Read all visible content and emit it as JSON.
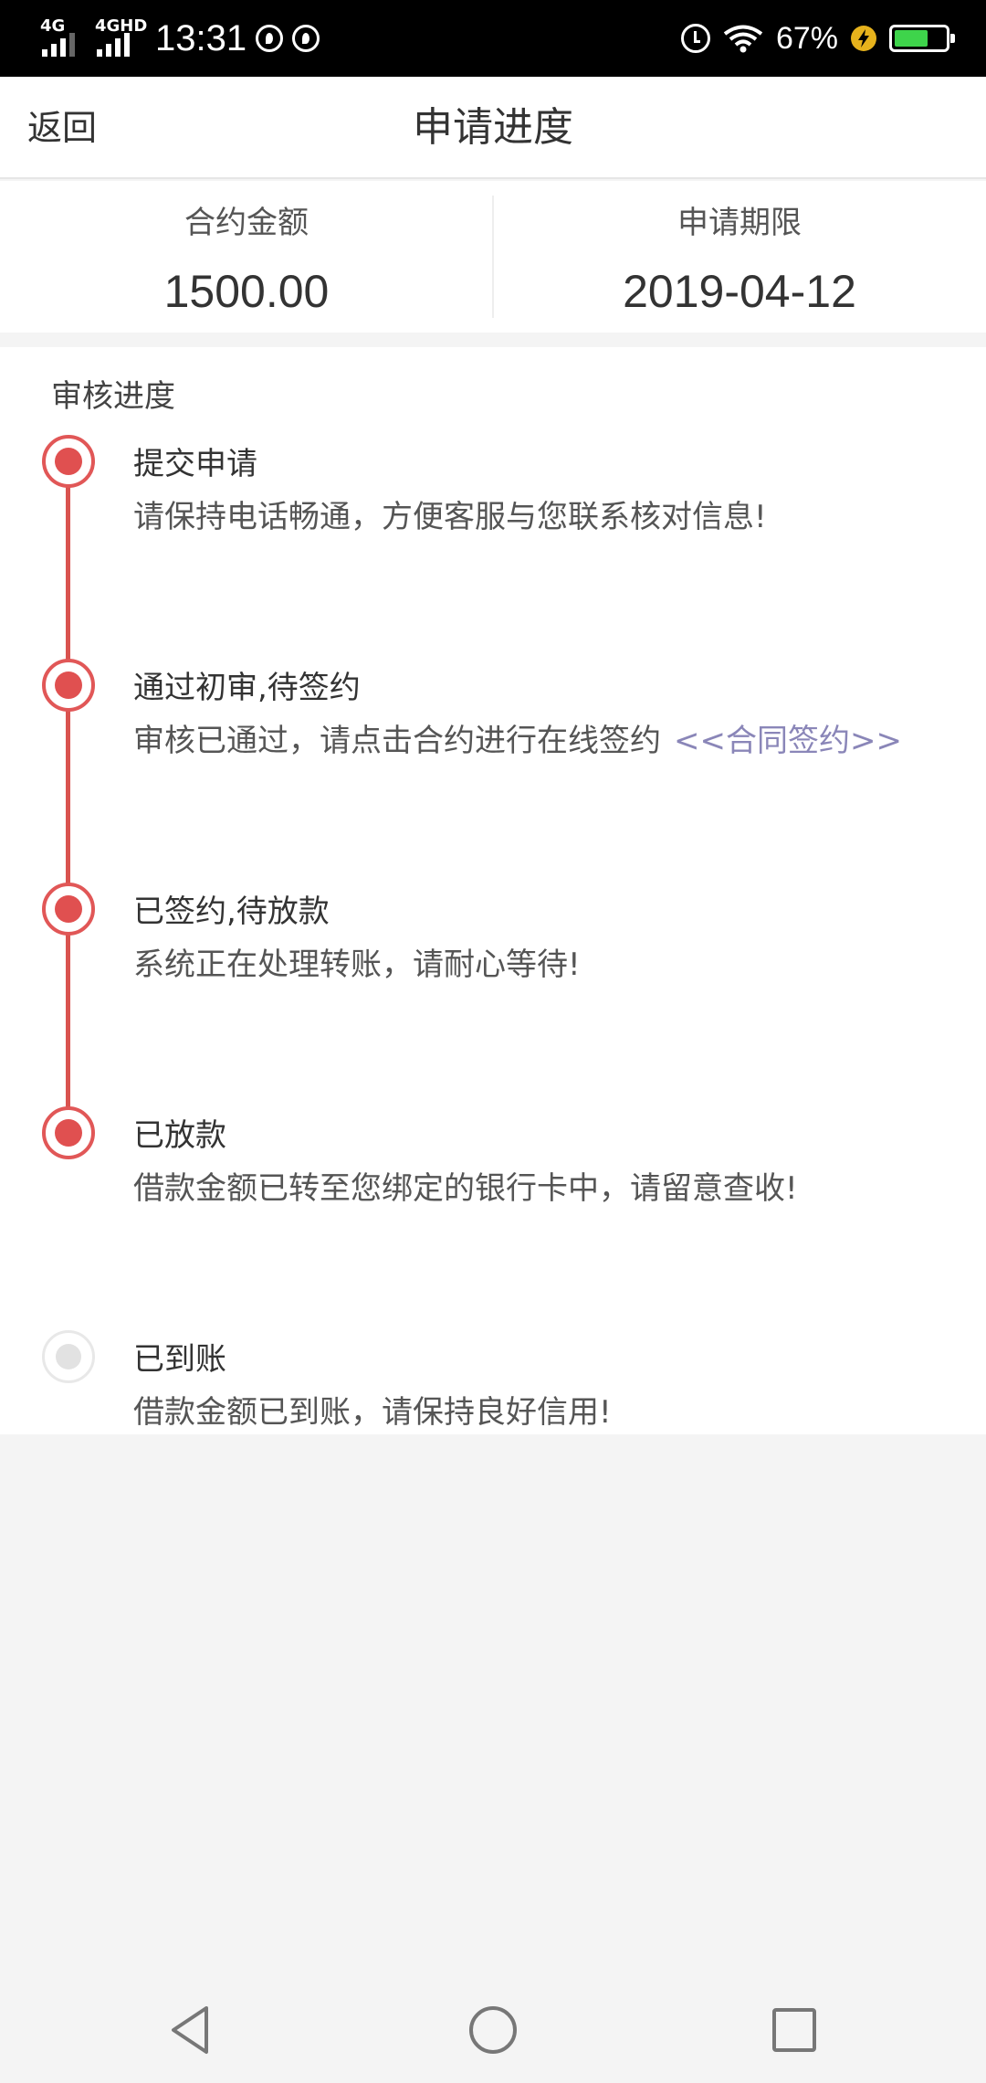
{
  "status_bar": {
    "network1": "4G",
    "network2": "4GHD",
    "time": "13:31",
    "battery_percent": "67%",
    "battery_level": 0.67,
    "icons": [
      "signal-icon",
      "circle-app-icon",
      "alarm-icon",
      "wifi-icon",
      "charging-icon",
      "battery-icon"
    ]
  },
  "header": {
    "back_label": "返回",
    "title": "申请进度"
  },
  "summary": {
    "amount_label": "合约金额",
    "amount_value": "1500.00",
    "period_label": "申请期限",
    "period_value": "2019-04-12"
  },
  "progress": {
    "heading": "审核进度",
    "steps": [
      {
        "title": "提交申请",
        "desc": "请保持电话畅通，方便客服与您联系核对信息!",
        "status": "done"
      },
      {
        "title": "通过初审,待签约",
        "desc": "审核已通过，请点击合约进行在线签约",
        "link": "<<合同签约>>",
        "status": "done"
      },
      {
        "title": "已签约,待放款",
        "desc": "系统正在处理转账，请耐心等待!",
        "status": "done"
      },
      {
        "title": "已放款",
        "desc": "借款金额已转至您绑定的银行卡中，请留意查收!",
        "status": "done"
      },
      {
        "title": "已到账",
        "desc": "借款金额已到账，请保持良好信用!",
        "status": "pending"
      }
    ]
  },
  "colors": {
    "accent": "#e05050",
    "link": "#8a86b8",
    "inactive": "#e2e2e2"
  }
}
